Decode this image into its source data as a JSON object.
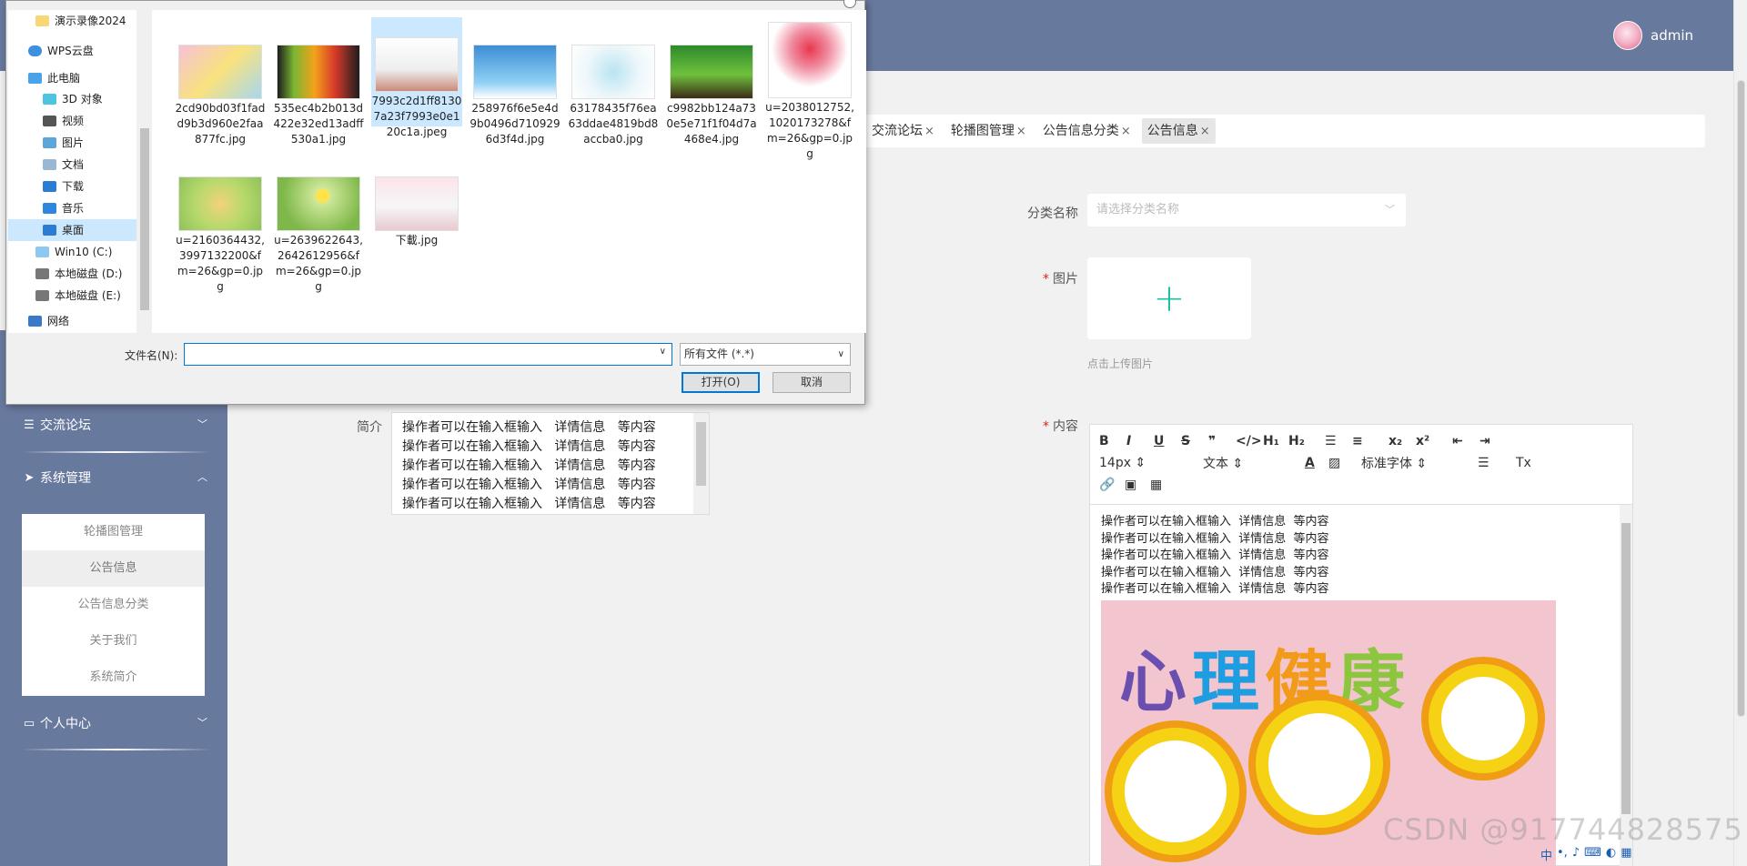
{
  "header": {
    "username": "admin"
  },
  "tabs": [
    {
      "label": "交流论坛",
      "close": "×"
    },
    {
      "label": "轮播图管理",
      "close": "×"
    },
    {
      "label": "公告信息分类",
      "close": "×"
    },
    {
      "label": "公告信息",
      "close": "×",
      "active": true
    }
  ],
  "sidebar": {
    "forum": "交流论坛",
    "system": "系统管理",
    "system_items": [
      "轮播图管理",
      "公告信息",
      "公告信息分类",
      "关于我们",
      "系统简介"
    ],
    "personal": "个人中心"
  },
  "form": {
    "category_label": "分类名称",
    "category_placeholder": "请选择分类名称",
    "image_label": "图片",
    "upload_hint": "点击上传图片",
    "intro_label": "简介",
    "intro_text": "操作者可以在输入框输入   详情信息   等内容\n操作者可以在输入框输入   详情信息   等内容\n操作者可以在输入框输入   详情信息   等内容\n操作者可以在输入框输入   详情信息   等内容\n操作者可以在输入框输入   详情信息   等内容",
    "content_label": "内容"
  },
  "editor": {
    "fontsize": "14px",
    "block": "文本",
    "fontfamily": "标准字体",
    "content_text": "操作者可以在输入框输入  详情信息  等内容\n操作者可以在输入框输入  详情信息  等内容\n操作者可以在输入框输入  详情信息  等内容\n操作者可以在输入框输入  详情信息  等内容\n操作者可以在输入框输入  详情信息  等内容",
    "poster_title": "心理健康"
  },
  "dialog": {
    "nav": [
      "演示录像2024",
      "WPS云盘",
      "此电脑",
      "3D 对象",
      "视频",
      "图片",
      "文档",
      "下载",
      "音乐",
      "桌面",
      "Win10 (C:)",
      "本地磁盘 (D:)",
      "本地磁盘 (E:)",
      "网络"
    ],
    "files": [
      "2cd90bd03f1fadd9b3d960e2faa877fc.jpg",
      "535ec4b2b013d422e32ed13adff530a1.jpg",
      "7993c2d1ff81307a23f7993e0e120c1a.jpeg",
      "258976f6e5e4d9b0496d7109296d3f4d.jpg",
      "63178435f76ea63ddae4819bd8accba0.jpg",
      "c9982bb124a730e5e71f1f04d7a468e4.jpg",
      "u=2038012752,1020173278&fm=26&gp=0.jpg",
      "u=2160364432,3997132200&fm=26&gp=0.jpg",
      "u=2639622643,2642612956&fm=26&gp=0.jpg",
      "下載.jpg"
    ],
    "filename_label": "文件名(N):",
    "filename_value": "",
    "filetype": "所有文件 (*.*)",
    "open": "打开(O)",
    "cancel": "取消"
  },
  "watermark": "CSDN @917744828575",
  "colors": {
    "header": "#68799e",
    "accent": "#1fbfa3",
    "selection": "#cce8ff"
  }
}
